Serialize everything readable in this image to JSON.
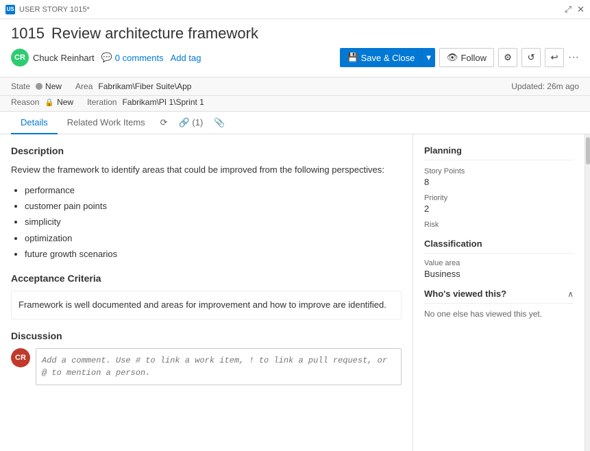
{
  "titleBar": {
    "label": "USER STORY 1015*",
    "expandIcon": "⤢",
    "closeIcon": "✕"
  },
  "header": {
    "workItemId": "1015",
    "workItemTitle": "Review architecture framework",
    "author": {
      "initials": "CR",
      "name": "Chuck Reinhart"
    },
    "commentsLabel": "0 comments",
    "addTagLabel": "Add tag",
    "saveCloseLabel": "Save & Close",
    "followLabel": "Follow",
    "settingsIcon": "⚙",
    "refreshIcon": "↺",
    "undoIcon": "↩",
    "moreIcon": "···"
  },
  "fields": {
    "stateLabel": "State",
    "stateValue": "New",
    "reasonLabel": "Reason",
    "reasonValue": "New",
    "areaLabel": "Area",
    "areaValue": "Fabrikam\\Fiber Suite\\App",
    "iterationLabel": "Iteration",
    "iterationValue": "Fabrikam\\PI 1\\Sprint 1",
    "updatedText": "Updated: 26m ago"
  },
  "tabs": {
    "details": "Details",
    "relatedWorkItems": "Related Work Items",
    "historyIcon": "⟳",
    "linkCount": "(1)",
    "linkIcon": "🔗",
    "attachIcon": "📎"
  },
  "leftPanel": {
    "descriptionTitle": "Description",
    "descriptionIntro": "Review the framework to identify areas that could be improved from the following perspectives:",
    "descriptionList": [
      "performance",
      "customer pain points",
      "simplicity",
      "optimization",
      "future growth scenarios"
    ],
    "acceptanceCriteriaTitle": "Acceptance Criteria",
    "acceptanceCriteriaText": "Framework is well documented and areas for improvement and how to improve are identified.",
    "discussionTitle": "Discussion",
    "commentPlaceholder": "Add a comment. Use # to link a work item, ! to link a pull request, or @ to mention a person.",
    "commentUserInitials": "CR"
  },
  "rightPanel": {
    "planningTitle": "Planning",
    "storyPointsLabel": "Story Points",
    "storyPointsValue": "8",
    "priorityLabel": "Priority",
    "priorityValue": "2",
    "riskLabel": "Risk",
    "riskValue": "",
    "classificationTitle": "Classification",
    "valueAreaLabel": "Value area",
    "valueAreaValue": "Business",
    "whosViewedTitle": "Who's viewed this?",
    "whosViewedText": "No one else has viewed this yet."
  }
}
